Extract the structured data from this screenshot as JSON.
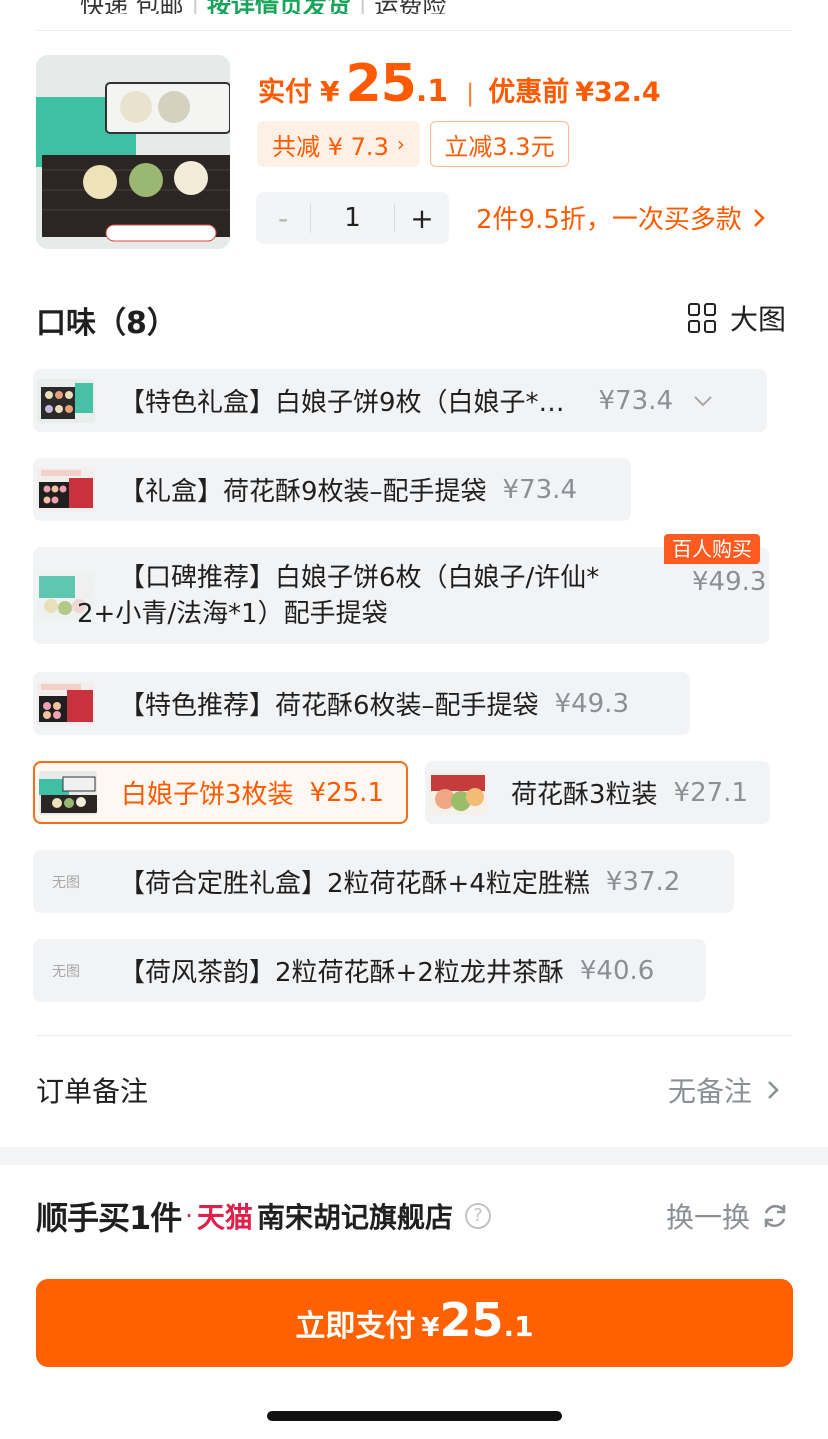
{
  "top_strip": {
    "prefix": "快递 包邮",
    "highlight": "按详情页发货",
    "suffix": "运费险"
  },
  "header": {
    "pay_label": "实付",
    "currency": "¥",
    "pay_int": "25",
    "pay_dec": ".1",
    "separator": "|",
    "before_label": "优惠前",
    "before_price": "¥32.4",
    "discount_total": "共减 ¥ 7.3",
    "instant_discount": "立减3.3元",
    "qty_minus": "-",
    "qty_value": "1",
    "qty_plus": "+",
    "multi_buy": "2件9.5折，一次买多款"
  },
  "flavor": {
    "title": "口味（8）",
    "big_image_label": "大图",
    "popular_badge": "百人购买",
    "options": [
      {
        "name": "【特色礼盒】白娘子饼9枚（白娘子*…",
        "price": "¥73.4"
      },
      {
        "name": "【礼盒】荷花酥9枚装–配手提袋",
        "price": "¥73.4"
      },
      {
        "name_line1": "【口碑推荐】白娘子饼6枚（白娘子/许仙*",
        "name_line2": "2+小青/法海*1）配手提袋",
        "price": "¥49.3"
      },
      {
        "name": "【特色推荐】荷花酥6枚装–配手提袋",
        "price": "¥49.3"
      },
      {
        "name": "白娘子饼3枚装",
        "price": "¥25.1",
        "selected": true
      },
      {
        "name": "荷花酥3粒装",
        "price": "¥27.1"
      },
      {
        "name": "【荷合定胜礼盒】2粒荷花酥+4粒定胜糕",
        "price": "¥37.2",
        "no_image": "无图"
      },
      {
        "name": "【荷风茶韵】2粒荷花酥+2粒龙井茶酥",
        "price": "¥40.6",
        "no_image": "无图"
      }
    ]
  },
  "order_note": {
    "label": "订单备注",
    "value": "无备注"
  },
  "buy_with": {
    "brand": "顺手买1件",
    "dot": "·",
    "tmall": "天猫",
    "store": "南宋胡记旗舰店",
    "help": "?",
    "swap": "换一换"
  },
  "pay_button": {
    "label": "立即支付",
    "currency": "¥",
    "int": "25",
    "dec": ".1"
  },
  "colors": {
    "accent": "#ff6000",
    "accent_text": "#ff5a00",
    "tmall_red": "#e0204a"
  }
}
